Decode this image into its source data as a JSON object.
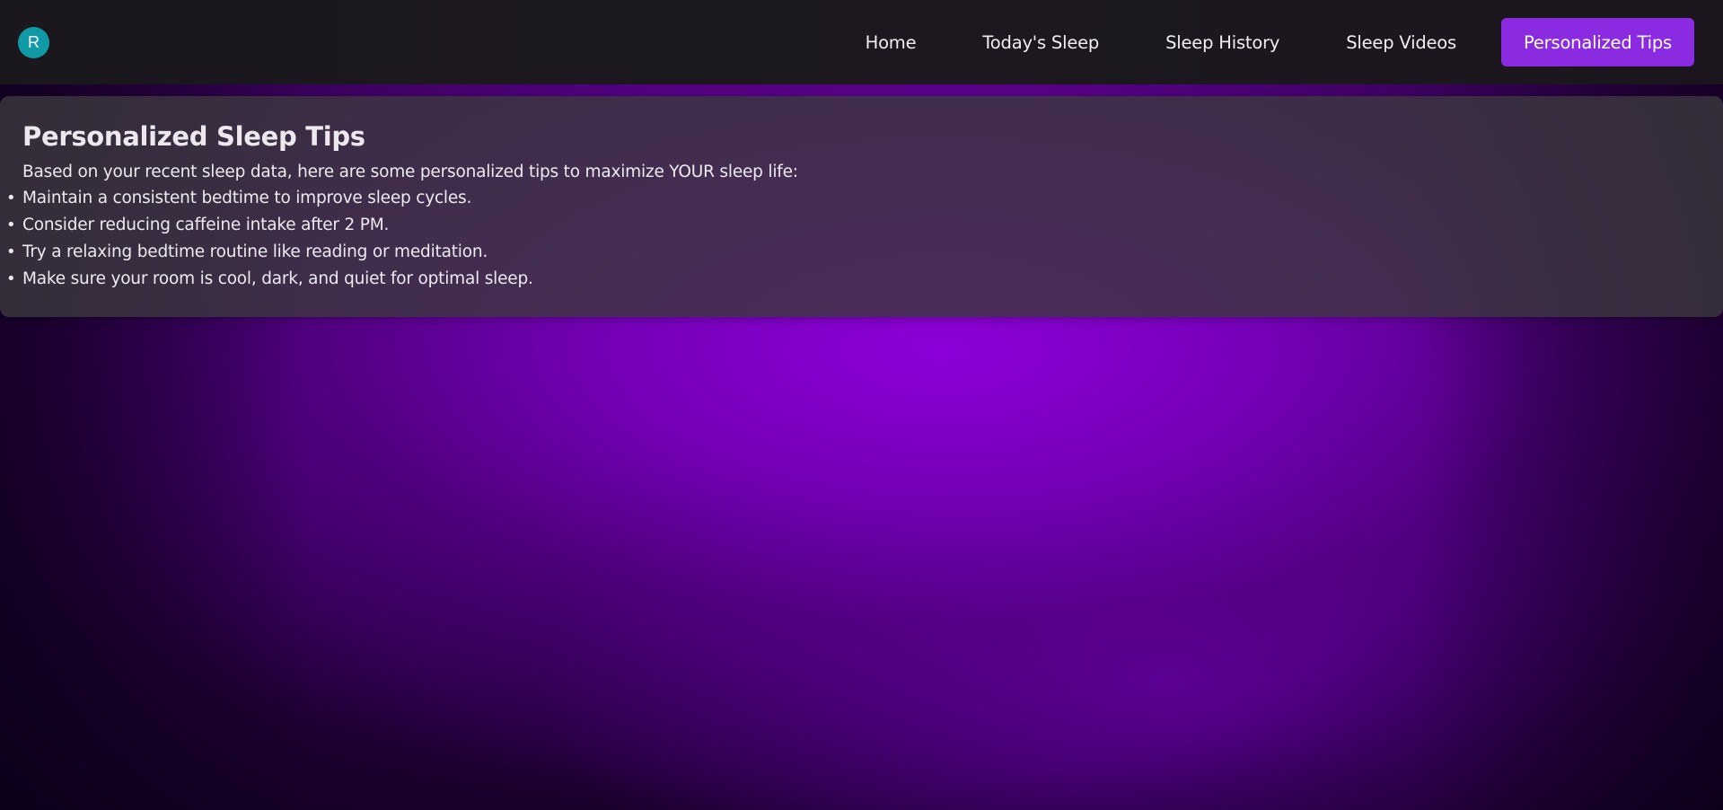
{
  "header": {
    "avatar_initial": "R",
    "nav": [
      {
        "label": "Home",
        "active": false
      },
      {
        "label": "Today's Sleep",
        "active": false
      },
      {
        "label": "Sleep History",
        "active": false
      },
      {
        "label": "Sleep Videos",
        "active": false
      },
      {
        "label": "Personalized Tips",
        "active": true
      }
    ]
  },
  "tips": {
    "title": "Personalized Sleep Tips",
    "intro": "Based on your recent sleep data, here are some personalized tips to maximize YOUR sleep life:",
    "items": [
      "Maintain a consistent bedtime to improve sleep cycles.",
      "Consider reducing caffeine intake after 2 PM.",
      "Try a relaxing bedtime routine like reading or meditation.",
      "Make sure your room is cool, dark, and quiet for optimal sleep."
    ]
  },
  "colors": {
    "accent": "#8a2be2",
    "avatar": "#0f9aa6",
    "navbar_bg": "#1b171e",
    "background": "#8c00d7"
  }
}
